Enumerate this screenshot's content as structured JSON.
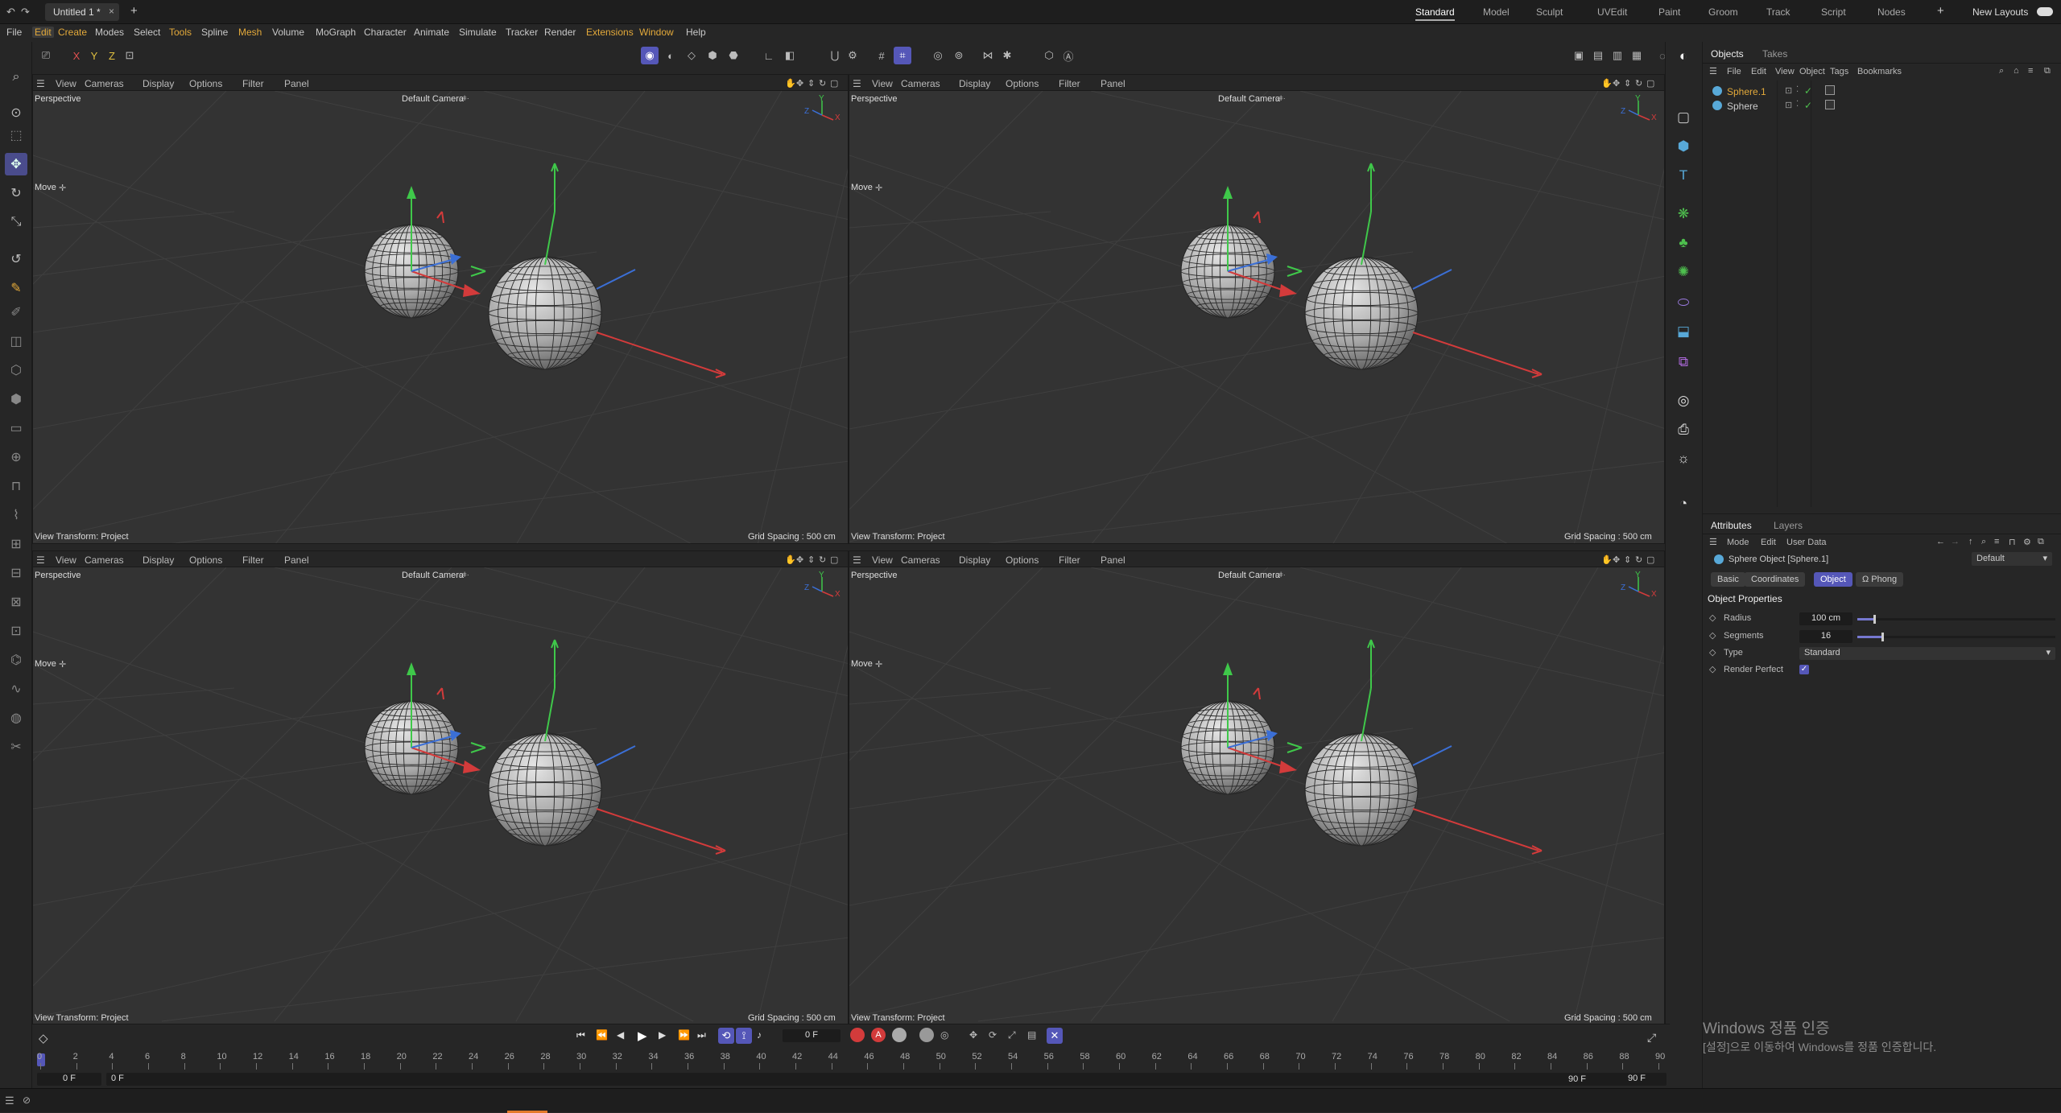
{
  "title_bar": {
    "doc_tab": "Untitled 1 *",
    "close_glyph": "×",
    "add_glyph": "+",
    "layouts": [
      "Standard",
      "Model",
      "Sculpt",
      "UVEdit",
      "Paint",
      "Groom",
      "Track",
      "Script",
      "Nodes"
    ],
    "add_layout_glyph": "+",
    "new_layouts": "New Layouts"
  },
  "menu": {
    "items": [
      "File",
      "Edit",
      "Create",
      "Modes",
      "Select",
      "Tools",
      "Spline",
      "Mesh",
      "Volume",
      "MoGraph",
      "Character",
      "Animate",
      "Simulate",
      "Tracker",
      "Render",
      "Extensions",
      "Window",
      "Help"
    ]
  },
  "toolbar": {
    "axis_labels": [
      "X",
      "Y",
      "Z"
    ]
  },
  "viewport": {
    "menus": [
      "View",
      "Cameras",
      "Display",
      "Options",
      "Filter",
      "Panel"
    ],
    "projection": "Perspective",
    "camera": "Default Camera",
    "camera_suffix": "·:ǂ·",
    "tool_label": "Move",
    "tool_icon": "✛",
    "transform": "View Transform: Project",
    "grid_spacing": "Grid Spacing : 500 cm",
    "axis_y": "Y",
    "axis_z": "Z",
    "axis_x": "X"
  },
  "objects_panel": {
    "tabs": [
      "Objects",
      "Takes"
    ],
    "menus": [
      "File",
      "Edit",
      "View",
      "Object",
      "Tags",
      "Bookmarks"
    ],
    "rows": [
      {
        "name": "Sphere.1",
        "selected": true
      },
      {
        "name": "Sphere",
        "selected": false
      }
    ]
  },
  "attributes_panel": {
    "tabs": [
      "Attributes",
      "Layers"
    ],
    "menus": [
      "Mode",
      "Edit",
      "User Data"
    ],
    "object_title": "Sphere Object [Sphere.1]",
    "preset": "Default",
    "sub_tabs": [
      "Basic",
      "Coordinates",
      "Object",
      "Ω Phong"
    ],
    "active_sub_tab": "Object",
    "section": "Object Properties",
    "props": [
      {
        "label": "Radius",
        "value": "100 cm",
        "slider": 0.08
      },
      {
        "label": "Segments",
        "value": "16",
        "slider": 0.12
      },
      {
        "label": "Type",
        "value": "Standard"
      },
      {
        "label": "Render Perfect",
        "checked": true
      }
    ],
    "check_glyph": "✓",
    "dropdown_glyph": "▾"
  },
  "timeline": {
    "current_frame": "0 F",
    "ticks": [
      "0",
      "2",
      "4",
      "6",
      "8",
      "10",
      "12",
      "14",
      "16",
      "18",
      "20",
      "22",
      "24",
      "26",
      "28",
      "30",
      "32",
      "34",
      "36",
      "38",
      "40",
      "42",
      "44",
      "46",
      "48",
      "50",
      "52",
      "54",
      "56",
      "58",
      "60",
      "62",
      "64",
      "66",
      "68",
      "70",
      "72",
      "74",
      "76",
      "78",
      "80",
      "82",
      "84",
      "86",
      "88",
      "90"
    ],
    "start_field": "0 F",
    "start_field2": "0 F",
    "end_field": "90 F",
    "end_field2": "90 F"
  },
  "watermark": {
    "line1": "Windows 정품 인증",
    "line2": "[설정]으로 이동하여 Windows를 정품 인증합니다."
  },
  "colors": {
    "accent": "#5557b8",
    "highlight": "#e3a93a",
    "object_icon": "#58a9d8",
    "axis_x": "#d33b3b",
    "axis_y": "#3fc84a",
    "axis_z": "#3b6fd6"
  }
}
